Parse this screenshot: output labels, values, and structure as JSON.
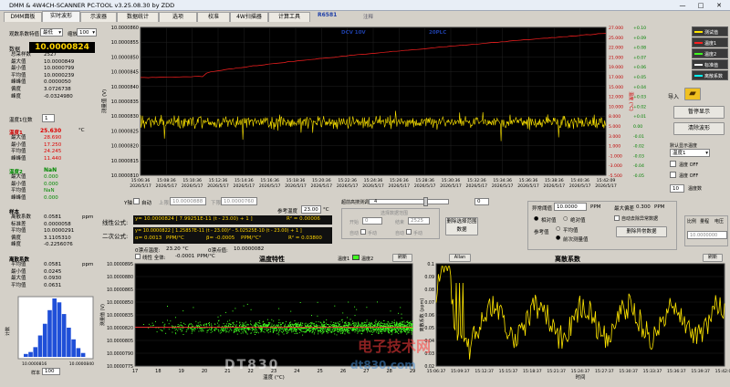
{
  "window": {
    "title": "DMM & 4W4CH-SCANNER PC-TOOL v3.25.08.30 by ZDD"
  },
  "tabs": [
    "DMM面板",
    "实时波形",
    "示波器",
    "数据统计",
    "选项",
    "校准",
    "4W扫描器",
    "计算工具"
  ],
  "tab_active": 1,
  "r_code": "R6581",
  "tab_extra": "注释",
  "left": {
    "sample_label": "观数系数特值",
    "sample_mode": "最低",
    "zoom_label": "缩放",
    "zoom_value": "100",
    "data_label": "数据",
    "data_value": "10.0000824",
    "stats": [
      [
        "总采样数",
        "2527"
      ],
      [
        "最大值",
        "10.0000849"
      ],
      [
        "最小值",
        "10.0000799"
      ],
      [
        "平均值",
        "10.0000239"
      ],
      [
        "峰峰值",
        "0.0000050"
      ],
      [
        "偏度",
        "3.0726738"
      ],
      [
        "峰度",
        "-0.0324980"
      ]
    ],
    "temp_decimal_label": "温度1位数",
    "temp_decimal_value": "1",
    "temp1_label": "温度1",
    "temp1_value": "25.630",
    "temp1_unit": "°C",
    "temp1_stats": [
      [
        "最大值",
        "28.690"
      ],
      [
        "最小值",
        "17.250"
      ],
      [
        "平均值",
        "24.245"
      ],
      [
        "峰峰值",
        "11.440"
      ]
    ],
    "temp2_label": "温度2",
    "temp2_value": "NaN",
    "temp2_stats": [
      [
        "最大值",
        "0.000"
      ],
      [
        "最小值",
        "0.000"
      ],
      [
        "平均值",
        "NaN"
      ],
      [
        "峰峰值",
        "0.000"
      ]
    ],
    "sample_sec": "样本",
    "sample_stats": [
      [
        "离散系数",
        "0.0581",
        "ppm"
      ],
      [
        "标准差",
        "0.0000058",
        ""
      ],
      [
        "平均值",
        "10.0000291",
        ""
      ],
      [
        "偏度",
        "3.1105310",
        ""
      ],
      [
        "峰度",
        "-0.2256076",
        ""
      ]
    ],
    "disc_sec": "离散系数",
    "disc_stats": [
      [
        "平均值",
        "0.0581",
        "ppm"
      ],
      [
        "最小值",
        "0.0245",
        ""
      ],
      [
        "最大值",
        "0.0930",
        ""
      ],
      [
        "平均值",
        "0.0631",
        ""
      ]
    ],
    "hist": {
      "ylabel": "计数",
      "x_left": "10.0000816",
      "x_right": "10.0000840",
      "samples_label": "样本",
      "samples_value": "100",
      "bars": [
        3,
        5,
        10,
        22,
        34,
        48,
        60,
        56,
        44,
        30,
        18,
        9,
        4
      ]
    }
  },
  "main_chart": {
    "top_label": "DCV  10V",
    "top_right": "20PLC",
    "ylabel": "测量值 (V)",
    "y2label": "温度 (°C)",
    "y_ticks": [
      "10.0000860",
      "10.0000855",
      "10.0000850",
      "10.0000845",
      "10.0000840",
      "10.0000835",
      "10.0000830",
      "10.0000825",
      "10.0000820",
      "10.0000815",
      "10.0000810"
    ],
    "y2_ticks": [
      "27.000",
      "25.000",
      "22.000",
      "21.000",
      "19.000",
      "17.000",
      "15.000",
      "12.000",
      "10.000",
      "8.000",
      "5.000",
      "3.000",
      "1.000",
      "-1.000",
      "-3.000",
      "-5.500"
    ],
    "y3_ticks": [
      "+0.10",
      "+0.09",
      "+0.08",
      "+0.07",
      "+0.06",
      "+0.05",
      "+0.04",
      "+0.03",
      "+0.02",
      "+0.01",
      "0.00",
      "-0.01",
      "-0.02",
      "-0.03",
      "-0.04",
      "-0.05"
    ],
    "x_ticks": [
      "15:06:36",
      "15:08:36",
      "15:10:36",
      "15:12:36",
      "15:14:36",
      "15:16:36",
      "15:18:36",
      "15:20:36",
      "15:22:36",
      "15:24:36",
      "15:26:36",
      "15:28:36",
      "15:30:36",
      "15:32:36",
      "15:34:36",
      "15:36:36",
      "15:38:36",
      "15:40:36",
      "15:42:09"
    ],
    "x_date": "2026/5/17"
  },
  "legend": [
    "测试值",
    "温度1",
    "温度2",
    "标准值",
    "离散系数"
  ],
  "right": {
    "import_label": "导入",
    "pause_label": "暂停显示",
    "clear_label": "清除波形",
    "temp_select_label": "默认显示温度",
    "temp_select_value": "温度1",
    "cb1": "温度 OFF",
    "cb2": "温度 OFF",
    "axis_label": "温度数",
    "axis_value": "10"
  },
  "mid": {
    "y_axis_label": "Y轴",
    "auto_label": "自动",
    "upper_label": "上限",
    "upper_value": "10.0000888",
    "lower_label": "下限",
    "lower_value": "10.0000760",
    "ref_temp_label": "参考温度",
    "ref_temp_value": "23.00",
    "ref_temp_unit": "°C",
    "linear_label": "线性公式:",
    "linear_formula": "y= 10.0000824 [ 7.99251E-11 (t - 23.00) + 1 ]",
    "linear_r2": "R² = 0.00006",
    "quad_label": "二次公式:",
    "quad_formula": "y= 10.0000822 [ 1.25857E-11 (t - 23.00)² - 5.02525E-10 (t - 23.00) + 1 ]",
    "alpha_label": "α=",
    "alpha_value": "0.0013",
    "alpha_unit": "PPM/°C",
    "beta_label": "β=",
    "beta_value": "-0.0005",
    "beta_unit": "PPM/°C²",
    "r2b": "R² = 0.03800",
    "zero_temp_label": "0漂点温度:",
    "zero_temp_value": "23.20",
    "zero_temp_unit": "°C",
    "zero_val_label": "0漂点值:",
    "zero_val_value": "10.0000082",
    "linear_coef_label": "线性 全体:",
    "linear_coef_value": "-0.0001",
    "linear_coef_unit": "PPM/°C",
    "range_label": "超前高搜测调整",
    "range_value": "4",
    "range_value2": "0",
    "select_title": "选择数据范围",
    "start_label": "开始",
    "start_value": "0",
    "end_label": "结束",
    "end_value": "2525",
    "auto2_label": "自动",
    "manual_label": "手动",
    "auto3_label": "自动",
    "manual2_label": "手动",
    "delete_sel_label": "删除选择范围数据",
    "anomaly_label": "异常阈值",
    "anomaly_value": "10.0000",
    "anomaly_unit": "PPM",
    "max_dev_label": "最大偏差",
    "max_dev_value": "0.300",
    "max_dev_unit": "PPM",
    "r_relative": "相对值",
    "r_absolute": "绝对值",
    "auto_del_label": "自动去除异常数据",
    "ref_label": "参考值",
    "ref_opt1": "平均值",
    "ref_opt2": "前次测量值",
    "del_anomaly_label": "删除异常数据",
    "ratio_label": "比例",
    "range2_label": "量程",
    "range2_value": "电压",
    "ratio_value": "10.0000000"
  },
  "temp_chart": {
    "title": "温度特性",
    "legend1": "温度1",
    "legend2": "温度2",
    "refresh": "刷新",
    "ylabel": "测量值 (V)",
    "xlabel": "温度 (°C)",
    "y_ticks": [
      "10.0000895",
      "10.0000880",
      "10.0000865",
      "10.0000850",
      "10.0000835",
      "10.0000820",
      "10.0000805",
      "10.0000790",
      "10.0000775"
    ],
    "x_ticks": [
      "17",
      "18",
      "19",
      "20",
      "21",
      "22",
      "23",
      "24",
      "25",
      "26",
      "27",
      "28",
      "29"
    ]
  },
  "disc_chart": {
    "allan": "Allan",
    "title": "离散系数",
    "refresh": "刷新",
    "ylabel": "离散系数 (ppm)",
    "xlabel": "时间",
    "y_ticks": [
      "0.1",
      "0.09",
      "0.08",
      "0.07",
      "0.06",
      "0.05",
      "0.04",
      "0.03",
      "0.02"
    ],
    "x_ticks": [
      "15:06:37",
      "15:09:37",
      "15:12:37",
      "15:15:37",
      "15:18:37",
      "15:21:37",
      "15:24:37",
      "15:27:37",
      "15:30:37",
      "15:33:37",
      "15:36:37",
      "15:39:37",
      "15:42:09"
    ]
  },
  "watermark": {
    "logo": "DT830",
    "site": "dt830.com",
    "cn": "电子技术网"
  },
  "colors": {
    "yellow": "#ffe600",
    "red": "#ff2020",
    "green": "#40ff20",
    "plotbg": "#000000",
    "lcd": "#ffd400"
  }
}
